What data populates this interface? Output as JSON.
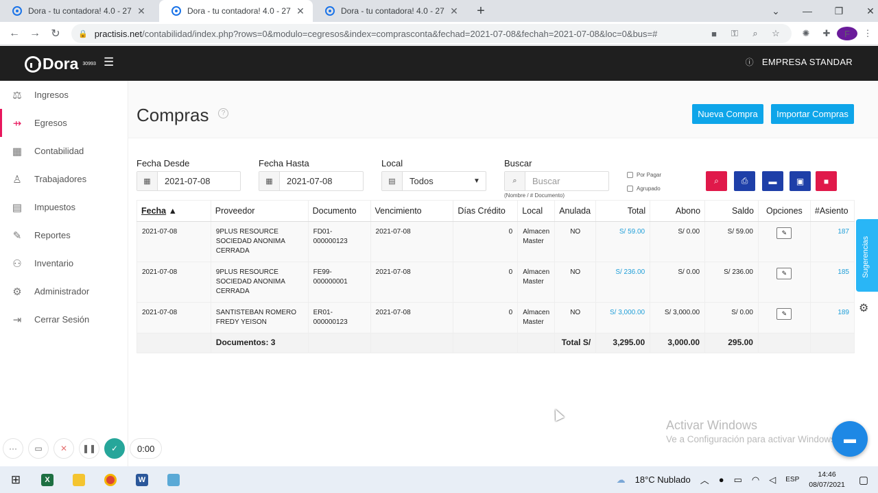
{
  "browser": {
    "tabs": [
      {
        "title": "Dora - tu contadora! 4.0 - 27"
      },
      {
        "title": "Dora - tu contadora! 4.0 - 27"
      },
      {
        "title": "Dora - tu contadora! 4.0 - 27"
      }
    ],
    "url_host": "practisis.net",
    "url_path": "/contabilidad/index.php?rows=0&modulo=cegresos&index=comprasconta&fechad=2021-07-08&fechah=2021-07-08&loc=0&bus=#",
    "profile_initial": "F"
  },
  "header": {
    "logo_text": "Dora",
    "logo_sub": "30993",
    "company": "EMPRESA STANDAR"
  },
  "sidebar": {
    "items": [
      {
        "label": "Ingresos",
        "icon": "income-icon"
      },
      {
        "label": "Egresos",
        "icon": "expenses-icon"
      },
      {
        "label": "Contabilidad",
        "icon": "calculator-icon"
      },
      {
        "label": "Trabajadores",
        "icon": "workers-icon"
      },
      {
        "label": "Impuestos",
        "icon": "taxes-icon"
      },
      {
        "label": "Reportes",
        "icon": "reports-icon"
      },
      {
        "label": "Inventario",
        "icon": "inventory-icon"
      },
      {
        "label": "Administrador",
        "icon": "gear-icon"
      },
      {
        "label": "Cerrar Sesión",
        "icon": "logout-icon"
      }
    ],
    "active": "Egresos"
  },
  "page": {
    "title": "Compras",
    "nueva_compra": "Nueva Compra",
    "importar_compras": "Importar Compras"
  },
  "filters": {
    "fecha_desde_label": "Fecha Desde",
    "fecha_desde": "2021-07-08",
    "fecha_hasta_label": "Fecha Hasta",
    "fecha_hasta": "2021-07-08",
    "local_label": "Local",
    "local_value": "Todos",
    "buscar_label": "Buscar",
    "buscar_placeholder": "Buscar",
    "buscar_hint": "(Nombre / # Documento)",
    "por_pagar": "Por Pagar",
    "agrupado": "Agrupado"
  },
  "table": {
    "headers": {
      "fecha": "Fecha",
      "proveedor": "Proveedor",
      "documento": "Documento",
      "vencimiento": "Vencimiento",
      "dias_credito": "Días Crédito",
      "local": "Local",
      "anulada": "Anulada",
      "total": "Total",
      "abono": "Abono",
      "saldo": "Saldo",
      "opciones": "Opciones",
      "asiento": "#Asiento"
    },
    "rows": [
      {
        "fecha": "2021-07-08",
        "proveedor": "9PLUS RESOURCE SOCIEDAD ANONIMA CERRADA",
        "documento": "FD01-000000123",
        "vencimiento": "2021-07-08",
        "dias_credito": "0",
        "local": "Almacen Master",
        "anulada": "NO",
        "total": "S/ 59.00",
        "abono": "S/ 0.00",
        "saldo": "S/ 59.00",
        "asiento": "187"
      },
      {
        "fecha": "2021-07-08",
        "proveedor": "9PLUS RESOURCE SOCIEDAD ANONIMA CERRADA",
        "documento": "FE99-000000001",
        "vencimiento": "2021-07-08",
        "dias_credito": "0",
        "local": "Almacen Master",
        "anulada": "NO",
        "total": "S/ 236.00",
        "abono": "S/ 0.00",
        "saldo": "S/ 236.00",
        "asiento": "185"
      },
      {
        "fecha": "2021-07-08",
        "proveedor": "SANTISTEBAN ROMERO FREDY YEISON",
        "documento": "ER01-000000123",
        "vencimiento": "2021-07-08",
        "dias_credito": "0",
        "local": "Almacen Master",
        "anulada": "NO",
        "total": "S/ 3,000.00",
        "abono": "S/ 3,000.00",
        "saldo": "S/ 0.00",
        "asiento": "189"
      }
    ],
    "totals": {
      "documentos": "Documentos: 3",
      "label": "Total S/",
      "total": "3,295.00",
      "abono": "3,000.00",
      "saldo": "295.00"
    }
  },
  "widgets": {
    "sugerencias": "Sugerencias",
    "recorder_time": "0:00"
  },
  "watermark": {
    "line1": "Activar Windows",
    "line2": "Ve a Configuración para activar Windows."
  },
  "taskbar": {
    "weather": "18°C  Nublado",
    "lang": "ESP",
    "time": "14:46",
    "date": "08/07/2021"
  },
  "colors": {
    "accent": "#0ea5e9",
    "active_nav": "#e8175d",
    "red_btn": "#e0194a",
    "navy_btn": "#1e3fa8"
  }
}
